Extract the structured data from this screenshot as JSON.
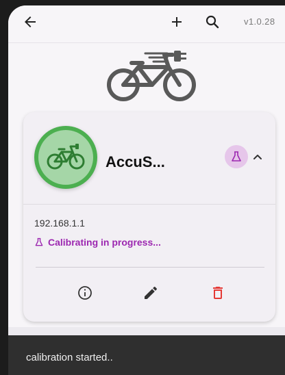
{
  "appbar": {
    "version": "v1.0.28",
    "icons": [
      "arrow-left-icon",
      "plus-icon",
      "search-icon"
    ]
  },
  "device": {
    "name": "AccuS...",
    "ip": "192.168.1.1",
    "status": "Calibrating in progress..."
  },
  "snackbar": {
    "message": "calibration started.."
  },
  "colors": {
    "accent_purple": "#9c27b0",
    "avatar_green": "#4caf50",
    "avatar_green_light": "#a5d6a7",
    "delete_red": "#e53935"
  }
}
